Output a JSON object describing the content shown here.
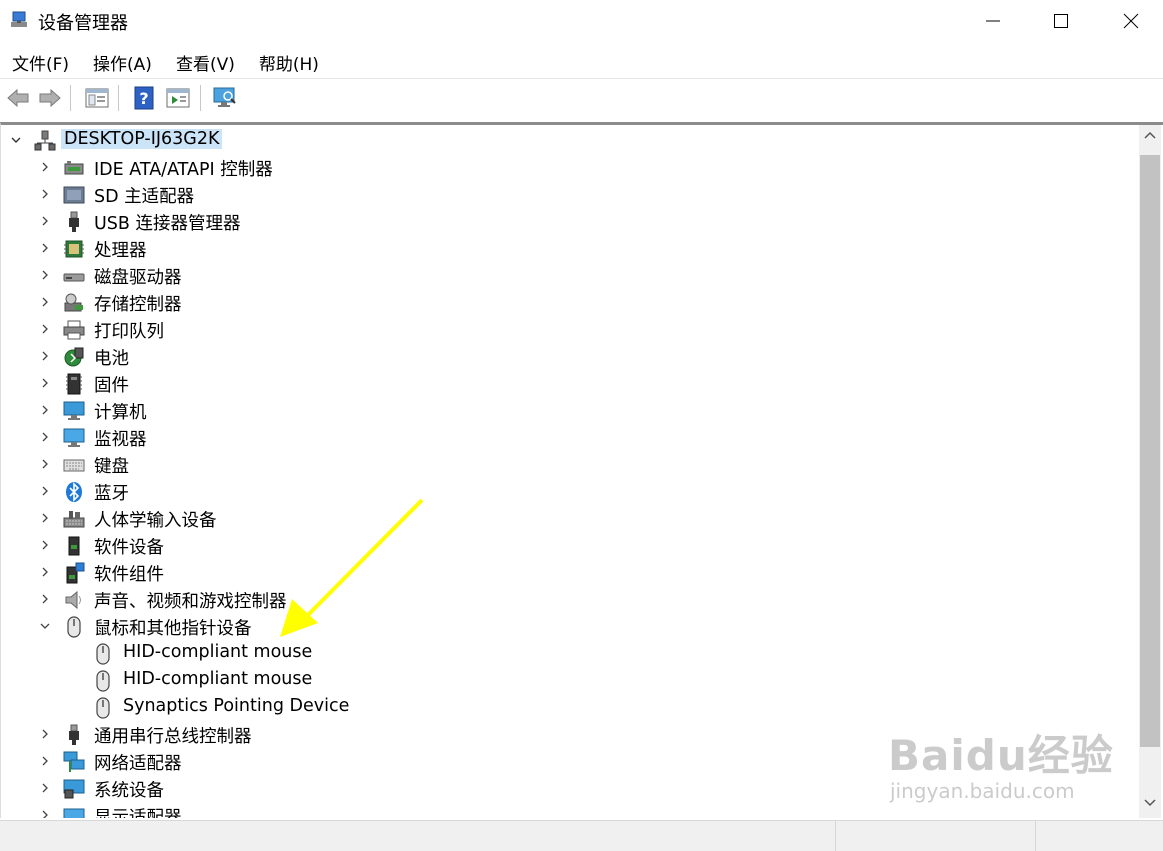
{
  "window": {
    "title": "设备管理器"
  },
  "menu": [
    "文件(F)",
    "操作(A)",
    "查看(V)",
    "帮助(H)"
  ],
  "tree": {
    "root": "DESKTOP-IJ63G2K",
    "items": [
      {
        "label": "IDE ATA/ATAPI 控制器",
        "icon": "ide-controller-icon",
        "expanded": false
      },
      {
        "label": "SD 主适配器",
        "icon": "sd-adapter-icon",
        "expanded": false
      },
      {
        "label": "USB 连接器管理器",
        "icon": "usb-connector-icon",
        "expanded": false
      },
      {
        "label": "处理器",
        "icon": "processor-icon",
        "expanded": false
      },
      {
        "label": "磁盘驱动器",
        "icon": "disk-drive-icon",
        "expanded": false
      },
      {
        "label": "存储控制器",
        "icon": "storage-controller-icon",
        "expanded": false
      },
      {
        "label": "打印队列",
        "icon": "printer-icon",
        "expanded": false
      },
      {
        "label": "电池",
        "icon": "battery-icon",
        "expanded": false
      },
      {
        "label": "固件",
        "icon": "firmware-icon",
        "expanded": false
      },
      {
        "label": "计算机",
        "icon": "computer-icon",
        "expanded": false
      },
      {
        "label": "监视器",
        "icon": "monitor-icon",
        "expanded": false
      },
      {
        "label": "键盘",
        "icon": "keyboard-icon",
        "expanded": false
      },
      {
        "label": "蓝牙",
        "icon": "bluetooth-icon",
        "expanded": false
      },
      {
        "label": "人体学输入设备",
        "icon": "hid-icon",
        "expanded": false
      },
      {
        "label": "软件设备",
        "icon": "software-device-icon",
        "expanded": false
      },
      {
        "label": "软件组件",
        "icon": "software-component-icon",
        "expanded": false
      },
      {
        "label": "声音、视频和游戏控制器",
        "icon": "speaker-icon",
        "expanded": false
      },
      {
        "label": "鼠标和其他指针设备",
        "icon": "mouse-icon",
        "expanded": true,
        "children": [
          "HID-compliant mouse",
          "HID-compliant mouse",
          "Synaptics Pointing Device"
        ]
      },
      {
        "label": "通用串行总线控制器",
        "icon": "usb-controller-icon",
        "expanded": false
      },
      {
        "label": "网络适配器",
        "icon": "network-adapter-icon",
        "expanded": false
      },
      {
        "label": "系统设备",
        "icon": "system-device-icon",
        "expanded": false
      },
      {
        "label": "显示适配器",
        "icon": "display-adapter-icon",
        "expanded": false
      }
    ]
  },
  "watermark": {
    "main": "Baidu经验",
    "sub": "jingyan.baidu.com"
  },
  "colors": {
    "selection": "#cce4f7",
    "arrow": "#ffff00"
  }
}
